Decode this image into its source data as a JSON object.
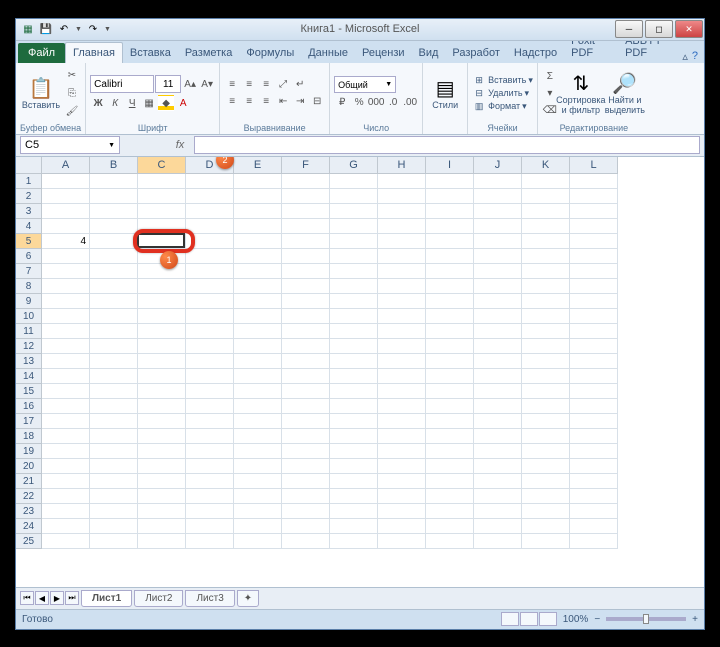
{
  "title": "Книга1 - Microsoft Excel",
  "tabs": {
    "file": "Файл",
    "home": "Главная",
    "insert": "Вставка",
    "layout": "Разметка",
    "formulas": "Формулы",
    "data": "Данные",
    "review": "Рецензи",
    "view": "Вид",
    "developer": "Разработ",
    "addins": "Надстро",
    "foxit": "Foxit PDF",
    "abbyy": "ABBYY PDF"
  },
  "ribbon": {
    "clipboard": {
      "paste": "Вставить",
      "label": "Буфер обмена"
    },
    "font": {
      "name": "Calibri",
      "size": "11",
      "label": "Шрифт"
    },
    "alignment": {
      "label": "Выравнивание"
    },
    "number": {
      "format": "Общий",
      "label": "Число"
    },
    "styles": {
      "btn": "Стили"
    },
    "cells": {
      "insert": "Вставить",
      "delete": "Удалить",
      "format": "Формат",
      "label": "Ячейки"
    },
    "editing": {
      "sort": "Сортировка и фильтр",
      "find": "Найти и выделить",
      "label": "Редактирование"
    }
  },
  "namebox": "C5",
  "columns": [
    "A",
    "B",
    "C",
    "D",
    "E",
    "F",
    "G",
    "H",
    "I",
    "J",
    "K",
    "L"
  ],
  "rows": [
    "1",
    "2",
    "3",
    "4",
    "5",
    "6",
    "7",
    "8",
    "9",
    "10",
    "11",
    "12",
    "13",
    "14",
    "15",
    "16",
    "17",
    "18",
    "19",
    "20",
    "21",
    "22",
    "23",
    "24",
    "25"
  ],
  "active_col": "C",
  "active_row": "5",
  "cell_data": {
    "A5": "4"
  },
  "sheets": {
    "s1": "Лист1",
    "s2": "Лист2",
    "s3": "Лист3"
  },
  "status": {
    "ready": "Готово",
    "zoom": "100%"
  },
  "callouts": {
    "fx": "2",
    "cell": "1"
  }
}
